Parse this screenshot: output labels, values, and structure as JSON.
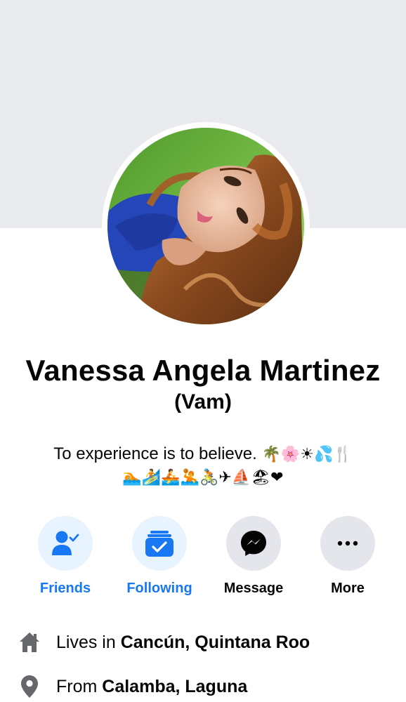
{
  "profile": {
    "name": "Vanessa Angela Martinez",
    "nickname": "(Vam)",
    "bio_line1": "To experience is to believe.",
    "bio_line1_emoji": "🌴🌸☀💦🍴",
    "bio_line2_emoji": "🏊🏄🚣🤽🚴✈⛵🏖❤"
  },
  "actions": [
    {
      "label": "Friends",
      "icon": "friends-check-icon",
      "color": "#1877f2"
    },
    {
      "label": "Following",
      "icon": "following-check-icon",
      "color": "#1877f2"
    },
    {
      "label": "Message",
      "icon": "messenger-icon",
      "color": "#050505"
    },
    {
      "label": "More",
      "icon": "more-dots-icon",
      "color": "#050505"
    }
  ],
  "info": {
    "lives_prefix": "Lives in ",
    "lives_place": "Cancún, Quintana Roo",
    "from_prefix": "From ",
    "from_place": "Calamba, Laguna"
  },
  "colors": {
    "cover": "#e9ebee",
    "accent": "#1877f2",
    "text": "#050505",
    "icon_grey": "#65676b"
  }
}
